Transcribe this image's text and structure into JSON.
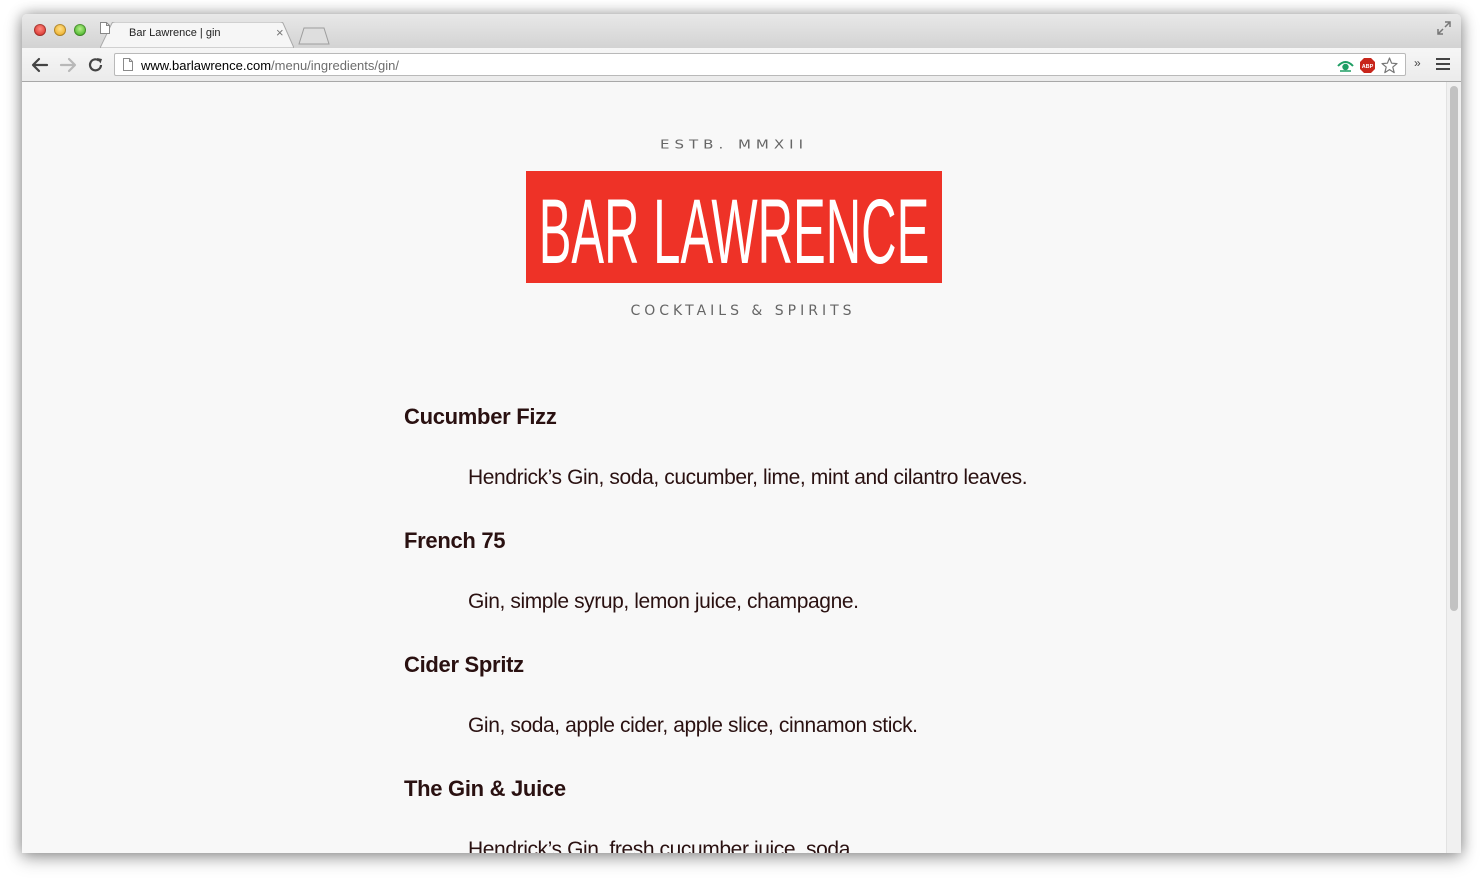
{
  "browser": {
    "tab_title": "Bar Lawrence | gin",
    "tab_close": "×",
    "url_host": "www.barlawrence.com",
    "url_path": "/menu/ingredients/gin/",
    "overflow_label": "»"
  },
  "site": {
    "established": "ESTB. MMXII",
    "logo_text": "BAR LAWRENCE",
    "tagline": "COCKTAILS & SPIRITS",
    "brand_color": "#ee3227",
    "text_color": "#2a1111"
  },
  "menu": {
    "items": [
      {
        "name": "Cucumber Fizz",
        "description": "Hendrick’s Gin, soda, cucumber, lime, mint and cilantro leaves."
      },
      {
        "name": "French 75",
        "description": "Gin, simple syrup, lemon juice, champagne."
      },
      {
        "name": "Cider Spritz",
        "description": "Gin, soda, apple cider, apple slice, cinnamon stick."
      },
      {
        "name": "The Gin & Juice",
        "description": "Hendrick’s Gin, fresh cucumber juice, soda."
      }
    ]
  },
  "icons": {
    "back": "arrow-left-icon",
    "forward": "arrow-right-icon",
    "reload": "reload-icon",
    "page": "document-icon",
    "extension_1": "green-eye-extension-icon",
    "extension_2": "adblock-plus-icon",
    "bookmark": "star-icon",
    "menu": "hamburger-menu-icon",
    "fullscreen": "fullscreen-icon"
  }
}
